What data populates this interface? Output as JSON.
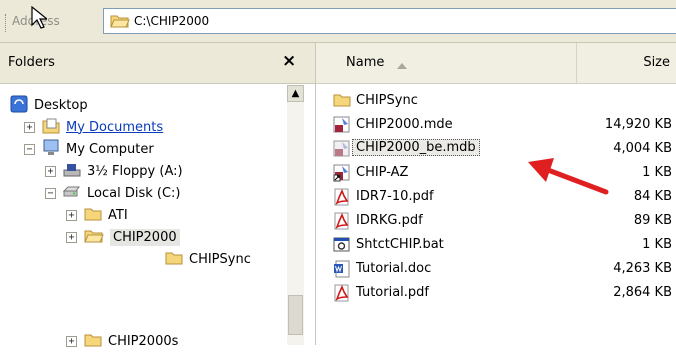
{
  "address": {
    "label": "Address",
    "value": "C:\\CHIP2000"
  },
  "folders_pane": {
    "title": "Folders",
    "close": "×",
    "tree": [
      {
        "id": "desktop",
        "label": "Desktop",
        "icon": "desktop-icon"
      },
      {
        "id": "my-documents",
        "label": "My Documents",
        "icon": "my-documents-icon",
        "expander": "+",
        "link": true
      },
      {
        "id": "my-computer",
        "label": "My Computer",
        "icon": "my-computer-icon",
        "expander": "−"
      },
      {
        "id": "floppy",
        "label": "3½ Floppy (A:)",
        "icon": "floppy-drive-icon",
        "expander": "+"
      },
      {
        "id": "local-disk",
        "label": "Local Disk (C:)",
        "icon": "hard-disk-icon",
        "expander": "−"
      },
      {
        "id": "ati",
        "label": "ATI",
        "icon": "folder-icon",
        "expander": "+"
      },
      {
        "id": "chip2000",
        "label": "CHIP2000",
        "icon": "open-folder-icon",
        "expander": "+",
        "selected": true
      },
      {
        "id": "chipsync",
        "label": "CHIPSync",
        "icon": "folder-icon"
      },
      {
        "id": "chip2000s",
        "label": "CHIP2000s",
        "icon": "folder-icon",
        "expander": "+"
      }
    ]
  },
  "file_list": {
    "columns": {
      "name": "Name",
      "size": "Size"
    },
    "files": [
      {
        "name": "CHIPSync",
        "size": "",
        "icon": "folder-icon"
      },
      {
        "name": "CHIP2000.mde",
        "size": "14,920 KB",
        "icon": "access-mde-icon"
      },
      {
        "name": "CHIP2000_be.mdb",
        "size": "4,004 KB",
        "icon": "access-mdb-icon",
        "selected": true
      },
      {
        "name": "CHIP-AZ",
        "size": "1 KB",
        "icon": "access-shortcut-icon"
      },
      {
        "name": "IDR7-10.pdf",
        "size": "84 KB",
        "icon": "pdf-icon"
      },
      {
        "name": "IDRKG.pdf",
        "size": "89 KB",
        "icon": "pdf-icon"
      },
      {
        "name": "ShtctCHIP.bat",
        "size": "1 KB",
        "icon": "batch-file-icon"
      },
      {
        "name": "Tutorial.doc",
        "size": "4,263 KB",
        "icon": "word-doc-icon"
      },
      {
        "name": "Tutorial.pdf",
        "size": "2,864 KB",
        "icon": "pdf-icon"
      }
    ]
  },
  "colors": {
    "toolbar": "#ece9d8",
    "link": "#0b3bbd",
    "folder": "#f5d67a",
    "arrow": "#e02020"
  }
}
